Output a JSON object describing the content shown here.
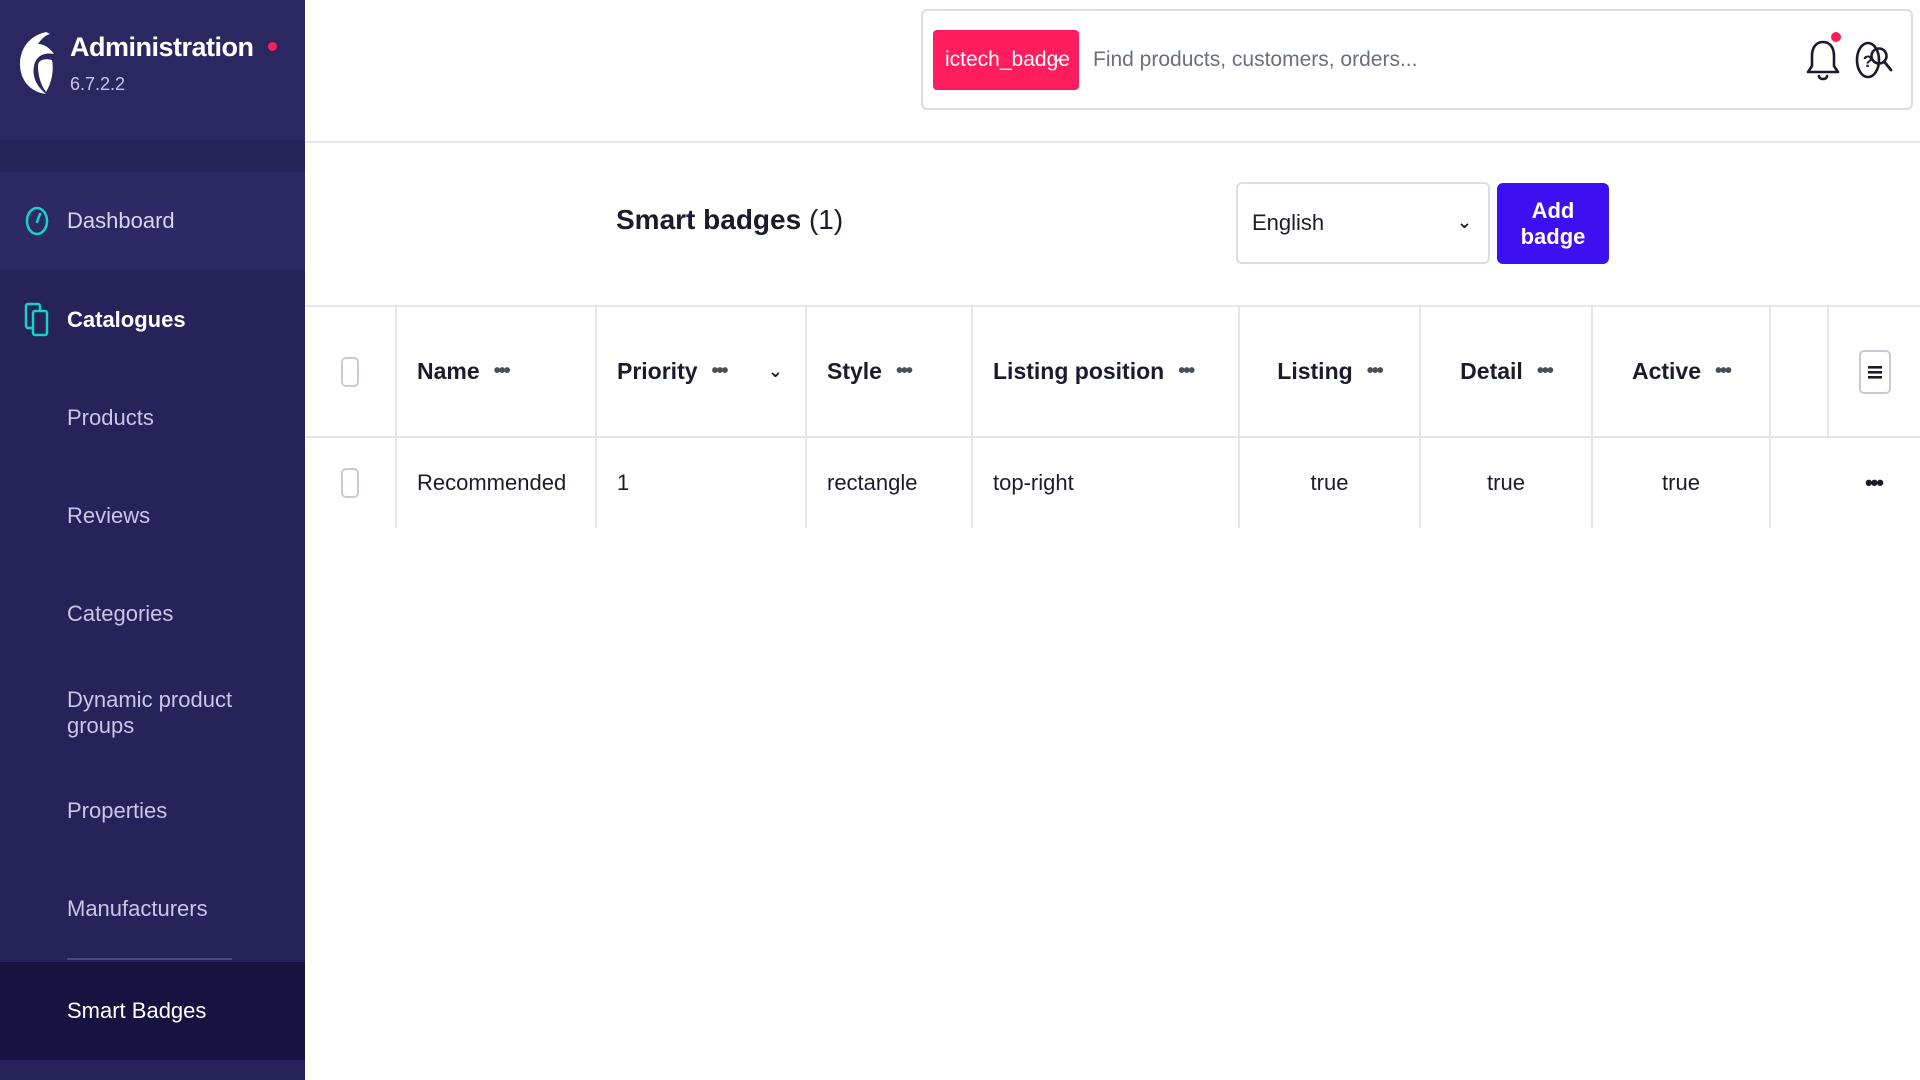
{
  "app": {
    "title": "Administration",
    "version": "6.7.2.2"
  },
  "sidebar": {
    "items": [
      {
        "label": "Dashboard",
        "icon": "gauge-icon"
      },
      {
        "label": "Catalogues",
        "icon": "catalogue-icon"
      },
      {
        "label": "Products"
      },
      {
        "label": "Reviews"
      },
      {
        "label": "Categories"
      },
      {
        "label": "Dynamic product groups"
      },
      {
        "label": "Properties"
      },
      {
        "label": "Manufacturers"
      },
      {
        "label": "Smart Badges"
      }
    ]
  },
  "search": {
    "type_label": "ictech_badge",
    "placeholder": "Find products, customers, orders..."
  },
  "page": {
    "title": "Smart badges",
    "count": "(1)",
    "language": "English",
    "add_label": "Add badge"
  },
  "table": {
    "columns": [
      "Name",
      "Priority",
      "Style",
      "Listing position",
      "Listing",
      "Detail",
      "Active"
    ],
    "rows": [
      {
        "name": "Recommended",
        "priority": "1",
        "style": "rectangle",
        "listing_position": "top-right",
        "listing": "true",
        "detail": "true",
        "active": "true"
      }
    ]
  },
  "colors": {
    "sidebar": "#26225a",
    "accent": "#ff1d5e",
    "primary": "#3c10f0",
    "icon_accent": "#19d2c6"
  }
}
